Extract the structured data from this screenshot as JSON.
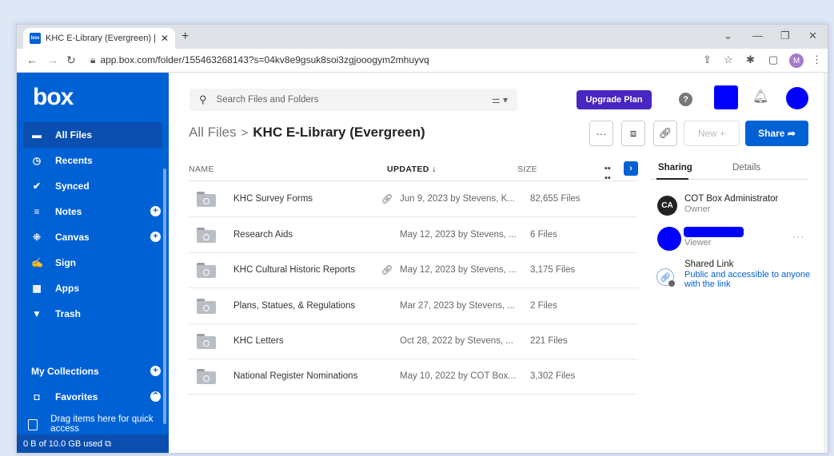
{
  "browser": {
    "tab_title": "KHC E-Library (Evergreen) | Powe",
    "favicon": "box",
    "url": "app.box.com/folder/155463268143?s=04kv8e9gsuk8soi3zgjooogym2mhuyvq",
    "profile_initial": "M"
  },
  "sidebar": {
    "logo": "box",
    "items": [
      {
        "label": "All Files",
        "icon": "folder-icon"
      },
      {
        "label": "Recents",
        "icon": "clock-icon"
      },
      {
        "label": "Synced",
        "icon": "check-circle-icon"
      },
      {
        "label": "Notes",
        "icon": "notes-icon"
      },
      {
        "label": "Canvas",
        "icon": "canvas-icon"
      },
      {
        "label": "Sign",
        "icon": "sign-icon"
      },
      {
        "label": "Apps",
        "icon": "apps-grid-icon"
      },
      {
        "label": "Trash",
        "icon": "trash-icon"
      }
    ],
    "collections_label": "My Collections",
    "favorites_label": "Favorites",
    "drag_hint": "Drag items here for quick access",
    "storage": "0 B of 10.0 GB used"
  },
  "header": {
    "search_placeholder": "Search Files and Folders",
    "upgrade_label": "Upgrade Plan",
    "help": "?"
  },
  "breadcrumb": {
    "parent": "All Files",
    "separator": ">",
    "current": "KHC E-Library (Evergreen)"
  },
  "actions": {
    "more": "···",
    "new_label": "New +",
    "share_label": "Share"
  },
  "table": {
    "columns": {
      "name": "NAME",
      "updated": "UPDATED ↓",
      "size": "SIZE"
    },
    "rows": [
      {
        "name": "KHC Survey Forms",
        "shared": true,
        "updated": "Jun 9, 2023 by Stevens, K...",
        "size": "82,655 Files"
      },
      {
        "name": "Research Aids",
        "shared": false,
        "updated": "May 12, 2023 by Stevens, ...",
        "size": "6 Files"
      },
      {
        "name": "KHC Cultural Historic Reports",
        "shared": true,
        "updated": "May 12, 2023 by Stevens, ...",
        "size": "3,175 Files"
      },
      {
        "name": "Plans, Statues, & Regulations",
        "shared": false,
        "updated": "Mar 27, 2023 by Stevens, ...",
        "size": "2 Files"
      },
      {
        "name": "KHC Letters",
        "shared": false,
        "updated": "Oct 28, 2022 by Stevens, ...",
        "size": "221 Files"
      },
      {
        "name": "National Register Nominations",
        "shared": false,
        "updated": "May 10, 2022 by COT Box...",
        "size": "3,302 Files"
      }
    ]
  },
  "panel": {
    "tabs": [
      "Sharing",
      "Details"
    ],
    "owner": {
      "initials": "CA",
      "name": "COT Box Administrator",
      "role": "Owner"
    },
    "viewer_role": "Viewer",
    "shared_link_title": "Shared Link",
    "shared_link_desc": "Public and accessible to anyone with the link"
  },
  "colors": {
    "brand": "#0061d5",
    "upgrade": "#4826c2",
    "redaction": "#0000ff"
  }
}
